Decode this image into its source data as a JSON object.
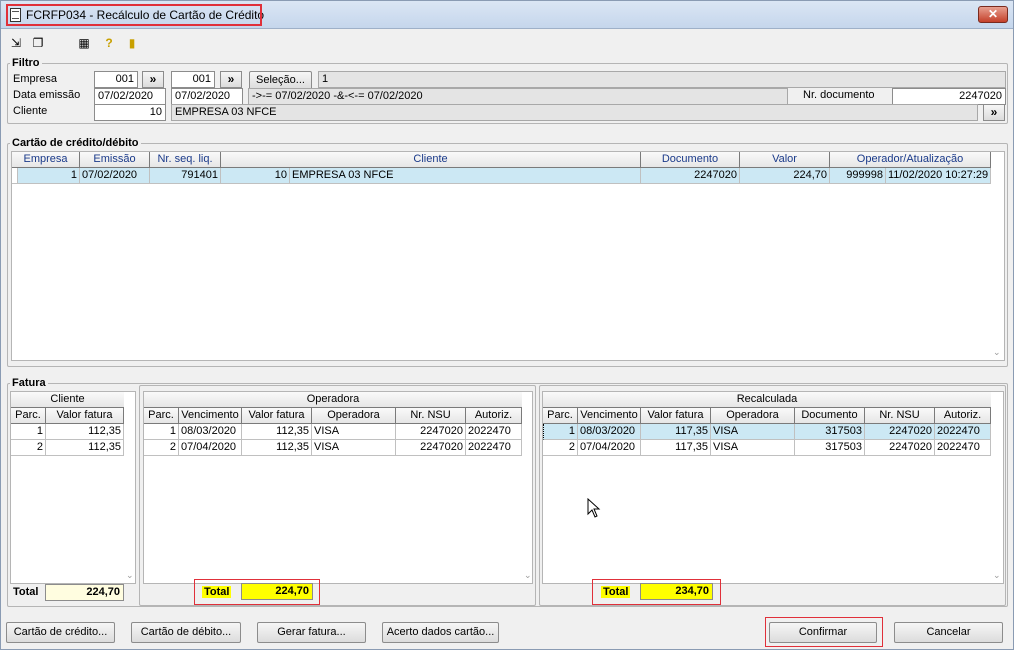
{
  "window": {
    "title": "FCRFP034 - Recálculo de Cartão de Crédito",
    "close_glyph": "✕"
  },
  "toolbar": {
    "icons": [
      "navigate-icon",
      "copy-icon",
      "calendar-icon",
      "help-icon",
      "exit-icon"
    ]
  },
  "filtro": {
    "label": "Filtro",
    "empresa_label": "Empresa",
    "empresa_from": "001",
    "empresa_to": "001",
    "arrow": "»",
    "selecao_label": "Seleção...",
    "selecao_value": "1",
    "data_label": "Data emissão",
    "data_from": "07/02/2020",
    "data_to": "07/02/2020",
    "data_expr": "->-= 07/02/2020 -&-<-= 07/02/2020",
    "nrdoc_label": "Nr. documento",
    "nrdoc_value": "2247020",
    "cliente_label": "Cliente",
    "cliente_code": "10",
    "cliente_name": "EMPRESA 03 NFCE"
  },
  "cartao": {
    "label": "Cartão de crédito/débito",
    "headers": [
      "Empresa",
      "Emissão",
      "Nr. seq. liq.",
      "Cliente",
      "Documento",
      "Valor",
      "Operador/Atualização"
    ],
    "row": {
      "empresa": "1",
      "emissao": "07/02/2020",
      "seq": "791401",
      "cliente_code": "10",
      "cliente_name": "EMPRESA 03 NFCE",
      "documento": "2247020",
      "valor": "224,70",
      "operador": "999998",
      "atualizacao": "11/02/2020 10:27:29"
    }
  },
  "fatura": {
    "label": "Fatura",
    "cliente": {
      "title": "Cliente",
      "headers": [
        "Parc.",
        "Valor fatura"
      ],
      "rows": [
        [
          "1",
          "112,35"
        ],
        [
          "2",
          "112,35"
        ]
      ],
      "total_label": "Total",
      "total": "224,70"
    },
    "operadora": {
      "title": "Operadora",
      "headers": [
        "Parc.",
        "Vencimento",
        "Valor fatura",
        "Operadora",
        "Nr. NSU",
        "Autoriz."
      ],
      "rows": [
        [
          "1",
          "08/03/2020",
          "112,35",
          "VISA",
          "2247020",
          "2022470"
        ],
        [
          "2",
          "07/04/2020",
          "112,35",
          "VISA",
          "2247020",
          "2022470"
        ]
      ],
      "total_label": "Total",
      "total": "224,70"
    },
    "recalculada": {
      "title": "Recalculada",
      "headers": [
        "Parc.",
        "Vencimento",
        "Valor fatura",
        "Operadora",
        "Documento",
        "Nr. NSU",
        "Autoriz."
      ],
      "rows": [
        [
          "1",
          "08/03/2020",
          "117,35",
          "VISA",
          "317503",
          "2247020",
          "2022470"
        ],
        [
          "2",
          "07/04/2020",
          "117,35",
          "VISA",
          "317503",
          "2247020",
          "2022470"
        ]
      ],
      "total_label": "Total",
      "total": "234,70"
    }
  },
  "buttons": {
    "cartao_credito": "Cartão de crédito...",
    "cartao_debito": "Cartão de débito...",
    "gerar_fatura": "Gerar fatura...",
    "acerto": "Acerto dados cartão...",
    "confirmar": "Confirmar",
    "cancelar": "Cancelar"
  },
  "colors": {
    "highlight": "#e0303a",
    "total_bg": "#ffff00",
    "selected_row": "#cce8f4",
    "header_text": "#1a3a8a"
  }
}
